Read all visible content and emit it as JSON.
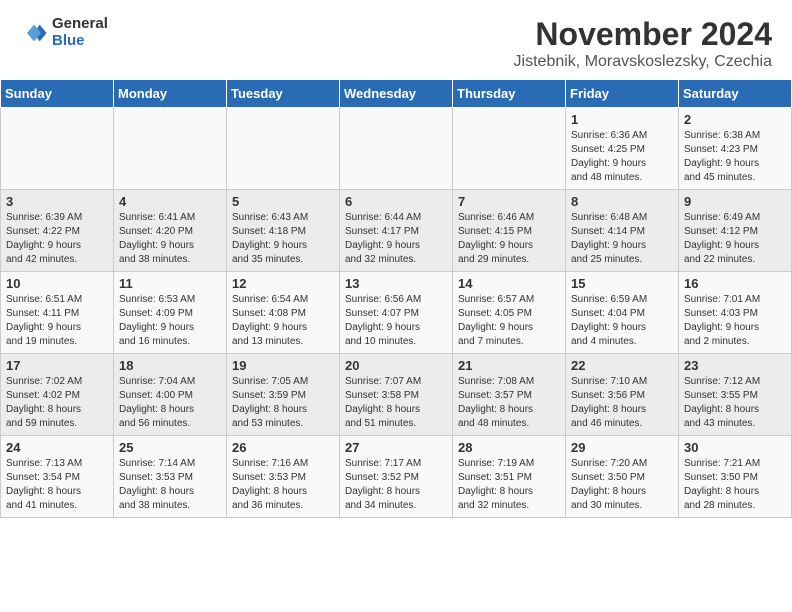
{
  "header": {
    "logo_general": "General",
    "logo_blue": "Blue",
    "month_title": "November 2024",
    "location": "Jistebnik, Moravskoslezsky, Czechia"
  },
  "weekdays": [
    "Sunday",
    "Monday",
    "Tuesday",
    "Wednesday",
    "Thursday",
    "Friday",
    "Saturday"
  ],
  "weeks": [
    [
      {
        "day": "",
        "info": ""
      },
      {
        "day": "",
        "info": ""
      },
      {
        "day": "",
        "info": ""
      },
      {
        "day": "",
        "info": ""
      },
      {
        "day": "",
        "info": ""
      },
      {
        "day": "1",
        "info": "Sunrise: 6:36 AM\nSunset: 4:25 PM\nDaylight: 9 hours\nand 48 minutes."
      },
      {
        "day": "2",
        "info": "Sunrise: 6:38 AM\nSunset: 4:23 PM\nDaylight: 9 hours\nand 45 minutes."
      }
    ],
    [
      {
        "day": "3",
        "info": "Sunrise: 6:39 AM\nSunset: 4:22 PM\nDaylight: 9 hours\nand 42 minutes."
      },
      {
        "day": "4",
        "info": "Sunrise: 6:41 AM\nSunset: 4:20 PM\nDaylight: 9 hours\nand 38 minutes."
      },
      {
        "day": "5",
        "info": "Sunrise: 6:43 AM\nSunset: 4:18 PM\nDaylight: 9 hours\nand 35 minutes."
      },
      {
        "day": "6",
        "info": "Sunrise: 6:44 AM\nSunset: 4:17 PM\nDaylight: 9 hours\nand 32 minutes."
      },
      {
        "day": "7",
        "info": "Sunrise: 6:46 AM\nSunset: 4:15 PM\nDaylight: 9 hours\nand 29 minutes."
      },
      {
        "day": "8",
        "info": "Sunrise: 6:48 AM\nSunset: 4:14 PM\nDaylight: 9 hours\nand 25 minutes."
      },
      {
        "day": "9",
        "info": "Sunrise: 6:49 AM\nSunset: 4:12 PM\nDaylight: 9 hours\nand 22 minutes."
      }
    ],
    [
      {
        "day": "10",
        "info": "Sunrise: 6:51 AM\nSunset: 4:11 PM\nDaylight: 9 hours\nand 19 minutes."
      },
      {
        "day": "11",
        "info": "Sunrise: 6:53 AM\nSunset: 4:09 PM\nDaylight: 9 hours\nand 16 minutes."
      },
      {
        "day": "12",
        "info": "Sunrise: 6:54 AM\nSunset: 4:08 PM\nDaylight: 9 hours\nand 13 minutes."
      },
      {
        "day": "13",
        "info": "Sunrise: 6:56 AM\nSunset: 4:07 PM\nDaylight: 9 hours\nand 10 minutes."
      },
      {
        "day": "14",
        "info": "Sunrise: 6:57 AM\nSunset: 4:05 PM\nDaylight: 9 hours\nand 7 minutes."
      },
      {
        "day": "15",
        "info": "Sunrise: 6:59 AM\nSunset: 4:04 PM\nDaylight: 9 hours\nand 4 minutes."
      },
      {
        "day": "16",
        "info": "Sunrise: 7:01 AM\nSunset: 4:03 PM\nDaylight: 9 hours\nand 2 minutes."
      }
    ],
    [
      {
        "day": "17",
        "info": "Sunrise: 7:02 AM\nSunset: 4:02 PM\nDaylight: 8 hours\nand 59 minutes."
      },
      {
        "day": "18",
        "info": "Sunrise: 7:04 AM\nSunset: 4:00 PM\nDaylight: 8 hours\nand 56 minutes."
      },
      {
        "day": "19",
        "info": "Sunrise: 7:05 AM\nSunset: 3:59 PM\nDaylight: 8 hours\nand 53 minutes."
      },
      {
        "day": "20",
        "info": "Sunrise: 7:07 AM\nSunset: 3:58 PM\nDaylight: 8 hours\nand 51 minutes."
      },
      {
        "day": "21",
        "info": "Sunrise: 7:08 AM\nSunset: 3:57 PM\nDaylight: 8 hours\nand 48 minutes."
      },
      {
        "day": "22",
        "info": "Sunrise: 7:10 AM\nSunset: 3:56 PM\nDaylight: 8 hours\nand 46 minutes."
      },
      {
        "day": "23",
        "info": "Sunrise: 7:12 AM\nSunset: 3:55 PM\nDaylight: 8 hours\nand 43 minutes."
      }
    ],
    [
      {
        "day": "24",
        "info": "Sunrise: 7:13 AM\nSunset: 3:54 PM\nDaylight: 8 hours\nand 41 minutes."
      },
      {
        "day": "25",
        "info": "Sunrise: 7:14 AM\nSunset: 3:53 PM\nDaylight: 8 hours\nand 38 minutes."
      },
      {
        "day": "26",
        "info": "Sunrise: 7:16 AM\nSunset: 3:53 PM\nDaylight: 8 hours\nand 36 minutes."
      },
      {
        "day": "27",
        "info": "Sunrise: 7:17 AM\nSunset: 3:52 PM\nDaylight: 8 hours\nand 34 minutes."
      },
      {
        "day": "28",
        "info": "Sunrise: 7:19 AM\nSunset: 3:51 PM\nDaylight: 8 hours\nand 32 minutes."
      },
      {
        "day": "29",
        "info": "Sunrise: 7:20 AM\nSunset: 3:50 PM\nDaylight: 8 hours\nand 30 minutes."
      },
      {
        "day": "30",
        "info": "Sunrise: 7:21 AM\nSunset: 3:50 PM\nDaylight: 8 hours\nand 28 minutes."
      }
    ]
  ]
}
